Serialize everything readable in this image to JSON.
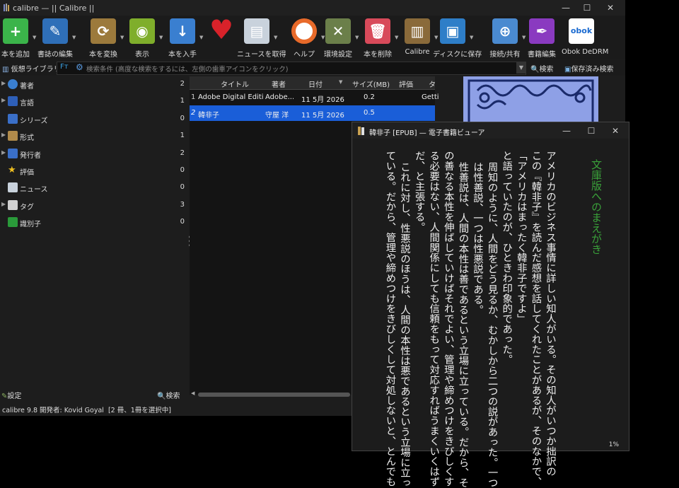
{
  "window": {
    "title": "calibre — || Calibre ||",
    "min": "—",
    "max": "☐",
    "close": "✕"
  },
  "toolbar": [
    {
      "label": "本を追加",
      "icon": "add-book-icon",
      "color": "#3bb44a",
      "glyph": "+"
    },
    {
      "label": "書誌の編集",
      "icon": "edit-metadata-icon",
      "color": "#2f6fb8",
      "glyph": "✎"
    },
    {
      "label": "本を変換",
      "icon": "convert-icon",
      "color": "#9c7a3c",
      "glyph": "⟳"
    },
    {
      "label": "表示",
      "icon": "view-icon",
      "color": "#7fae2b",
      "glyph": "◉"
    },
    {
      "label": "本を入手",
      "icon": "get-books-icon",
      "color": "#3a7fd0",
      "glyph": "↓"
    },
    {
      "label": "",
      "icon": "heart-icon",
      "color": "#d8222a",
      "glyph": "♥"
    },
    {
      "label": "ニュースを取得",
      "icon": "news-icon",
      "color": "#c9d2dc",
      "glyph": "▤"
    },
    {
      "label": "ヘルプ",
      "icon": "help-icon",
      "color": "#e86a2a",
      "glyph": "◎"
    },
    {
      "label": "環境設定",
      "icon": "preferences-icon",
      "color": "#6b7f4a",
      "glyph": "✕"
    },
    {
      "label": "本を削除",
      "icon": "remove-books-icon",
      "color": "#d84a5a",
      "glyph": "🗑"
    },
    {
      "label": "Calibre",
      "icon": "library-icon",
      "color": "#8a6a3a",
      "glyph": "▥"
    },
    {
      "label": "ディスクに保存",
      "icon": "save-to-disk-icon",
      "color": "#2e7ec8",
      "glyph": "▣"
    },
    {
      "label": "接続/共有",
      "icon": "connect-share-icon",
      "color": "#4a8ad0",
      "glyph": "⊕"
    },
    {
      "label": "書籍編集",
      "icon": "edit-book-icon",
      "color": "#8a3ac0",
      "glyph": "✒"
    },
    {
      "label": "Obok DeDRM",
      "icon": "obok-icon",
      "color": "#ffffff",
      "glyph": "obok"
    }
  ],
  "search": {
    "virtual_library": "仮想ライブラリ",
    "placeholder": "検索条件 (高度な検索をするには、左側の歯車アイコンをクリック)",
    "search_label": "検索",
    "saved_search_label": "保存済み検索"
  },
  "categories": [
    {
      "label": "著者",
      "count": "2",
      "expand": true,
      "color": "#3a7fd0"
    },
    {
      "label": "言語",
      "count": "1",
      "expand": true,
      "color": "#2e5fb8"
    },
    {
      "label": "シリーズ",
      "count": "0",
      "expand": false,
      "color": "#3a6fc8"
    },
    {
      "label": "形式",
      "count": "1",
      "expand": true,
      "color": "#b08a4a"
    },
    {
      "label": "発行者",
      "count": "2",
      "expand": true,
      "color": "#3a6fc8"
    },
    {
      "label": "評価",
      "count": "0",
      "expand": false,
      "color": "#f0c020"
    },
    {
      "label": "ニュース",
      "count": "0",
      "expand": false,
      "color": "#c9d2dc"
    },
    {
      "label": "タグ",
      "count": "3",
      "expand": true,
      "color": "#d0d0d0"
    },
    {
      "label": "識別子",
      "count": "0",
      "expand": false,
      "color": "#2a9a3a"
    }
  ],
  "left_footer": {
    "settings": "設定",
    "search": "検索"
  },
  "table": {
    "headers": [
      "タイトル",
      "著者",
      "日付",
      "サイズ(MB)",
      "評価",
      "タ"
    ],
    "rows": [
      {
        "num": "1",
        "title": "Adobe Digital Editio...",
        "author": "Adobe...",
        "date": "11 5月 2026",
        "size": "0.2",
        "tags": "Getti"
      },
      {
        "num": "2",
        "title": "韓非子",
        "author": "守屋 洋",
        "date": "11 5月 2026",
        "size": "0.5",
        "tags": ""
      }
    ]
  },
  "status": "calibre 9.8 開発者: Kovid Goyal  [2 冊、1冊を選択中]",
  "viewer": {
    "title": "韓非子 [EPUB] — 電子書籍ビューア",
    "progress": "1%",
    "heading": "文庫版へのまえがき",
    "lines": [
      "アメリカのビジネス事情に詳しい知人がいる。その知人がいつか拙訳の",
      "この『韓非子』を読んだ感想を話してくれたことがあるが、そのなかで、",
      "「アメリカはまったく韓非子ですよ」",
      "と語っていたのが、ひときわ印象的であった。",
      "周知のように、人間をどう見るか、むかしから二つの説があった。一つ",
      "は性善説、一つは性悪説である。",
      "性善説は、人間の本性は善であるという立場に立っている。だから、そ",
      "の善なる本性を伸ばしていけばそれでよい、管理や締めつけをきびしくす",
      "る必要はない、人間関係にしても信頼をもって対応すればうまくいくはず",
      "だ、と主張する。",
      "これに対し、性悪説のほうは、人間の本性は悪であるという立場に立っ",
      "ている。だから、管理や締めつけをきびしくして対処しないと、とんでも"
    ],
    "heading_color": "#3aa23a"
  }
}
